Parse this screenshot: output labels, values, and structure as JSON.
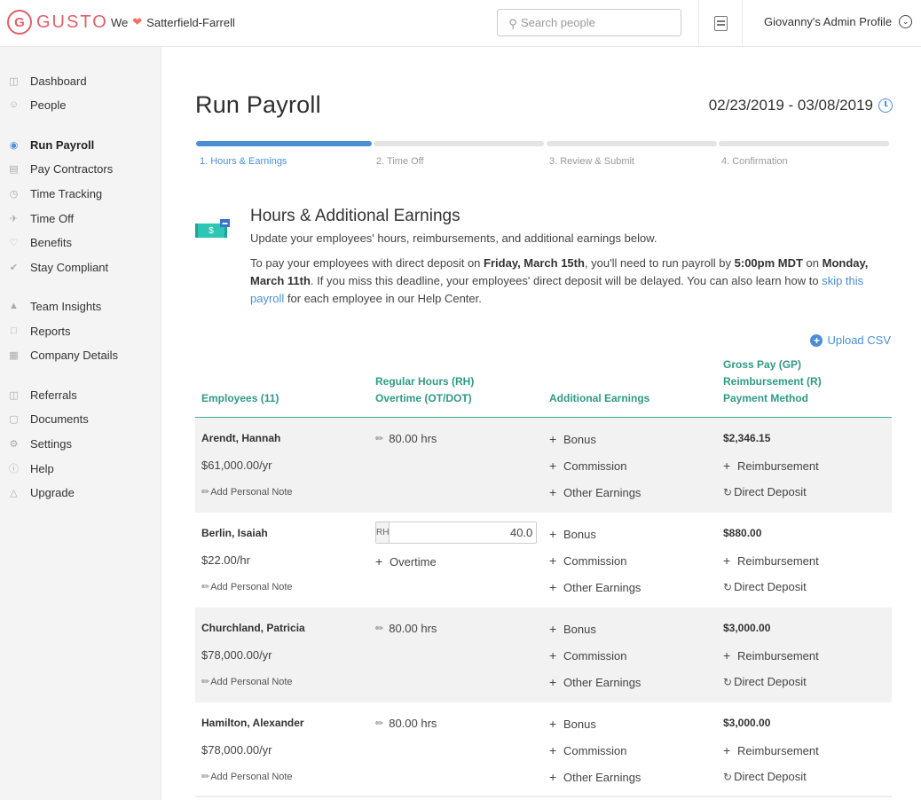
{
  "header": {
    "brand": "GUSTO",
    "brand_mark": "G",
    "we_label": "We",
    "company": "Satterfield-Farrell",
    "search_placeholder": "Search people",
    "profile_label": "Giovanny's Admin Profile",
    "brand_color": "#e0606a"
  },
  "sidebar": {
    "items": [
      {
        "label": "Dashboard",
        "icon": "dashboard-icon"
      },
      {
        "label": "People",
        "icon": "person-icon"
      },
      {
        "label": "Run Payroll",
        "icon": "money-bag-icon",
        "active": true
      },
      {
        "label": "Pay Contractors",
        "icon": "cash-icon"
      },
      {
        "label": "Time Tracking",
        "icon": "clock-icon"
      },
      {
        "label": "Time Off",
        "icon": "plane-icon"
      },
      {
        "label": "Benefits",
        "icon": "heart-icon"
      },
      {
        "label": "Stay Compliant",
        "icon": "check-icon"
      },
      {
        "label": "Team Insights",
        "icon": "chart-icon"
      },
      {
        "label": "Reports",
        "icon": "folder-icon"
      },
      {
        "label": "Company Details",
        "icon": "building-icon"
      },
      {
        "label": "Referrals",
        "icon": "gift-icon"
      },
      {
        "label": "Documents",
        "icon": "document-icon"
      },
      {
        "label": "Settings",
        "icon": "gear-icon"
      },
      {
        "label": "Help",
        "icon": "help-icon"
      },
      {
        "label": "Upgrade",
        "icon": "upgrade-icon"
      }
    ]
  },
  "page": {
    "title": "Run Payroll",
    "date_range": "02/23/2019 - 03/08/2019",
    "steps": [
      {
        "label": "1. Hours & Earnings",
        "active": true
      },
      {
        "label": "2. Time Off",
        "active": false
      },
      {
        "label": "3. Review & Submit",
        "active": false
      },
      {
        "label": "4. Confirmation",
        "active": false
      }
    ],
    "intro": {
      "title": "Hours & Additional Earnings",
      "subtitle": "Update your employees' hours, reimbursements, and additional earnings below.",
      "para_1": "To pay your employees with direct deposit on ",
      "bold_1": "Friday, March 15th",
      "para_2": ", you'll need to run payroll by ",
      "bold_2": "5:00pm MDT",
      "para_3": " on ",
      "bold_3": "Monday, March 11th",
      "para_4": ". If you miss this deadline, your employees' direct deposit will be delayed. You can also learn how to ",
      "link": "skip this payroll",
      "para_5": " for each employee in our Help Center."
    },
    "upload_csv": "Upload CSV",
    "accent_color": "#4a8fd6",
    "header_color": "#2e9a86"
  },
  "table": {
    "headers": {
      "employees": "Employees (11)",
      "hours_1": "Regular Hours (RH)",
      "hours_2": "Overtime (OT/DOT)",
      "additional": "Additional Earnings",
      "pay_1": "Gross Pay (GP)",
      "pay_2": "Reimbursement (R)",
      "pay_3": "Payment Method"
    },
    "rows": [
      {
        "name": "Arendt, Hannah",
        "rate": "$61,000.00/yr",
        "note": "Add Personal Note",
        "hours": "80.00 hrs",
        "bonus": "Bonus",
        "commission": "Commission",
        "other": "Other Earnings",
        "gross": "$2,346.15",
        "reimbursement": "Reimbursement",
        "payment": "Direct Deposit"
      },
      {
        "name": "Berlin, Isaiah",
        "rate": "$22.00/hr",
        "note": "Add Personal Note",
        "rh_tag": "RH",
        "rh_value": "40.0 hr",
        "overtime": "Overtime",
        "bonus": "Bonus",
        "commission": "Commission",
        "other": "Other Earnings",
        "gross": "$880.00",
        "reimbursement": "Reimbursement",
        "payment": "Direct Deposit"
      },
      {
        "name": "Churchland, Patricia",
        "rate": "$78,000.00/yr",
        "note": "Add Personal Note",
        "hours": "80.00 hrs",
        "bonus": "Bonus",
        "commission": "Commission",
        "other": "Other Earnings",
        "gross": "$3,000.00",
        "reimbursement": "Reimbursement",
        "payment": "Direct Deposit"
      },
      {
        "name": "Hamilton, Alexander",
        "rate": "$78,000.00/yr",
        "note": "Add Personal Note",
        "hours": "80.00 hrs",
        "bonus": "Bonus",
        "commission": "Commission",
        "other": "Other Earnings",
        "gross": "$3,000.00",
        "reimbursement": "Reimbursement",
        "payment": "Direct Deposit"
      }
    ]
  }
}
